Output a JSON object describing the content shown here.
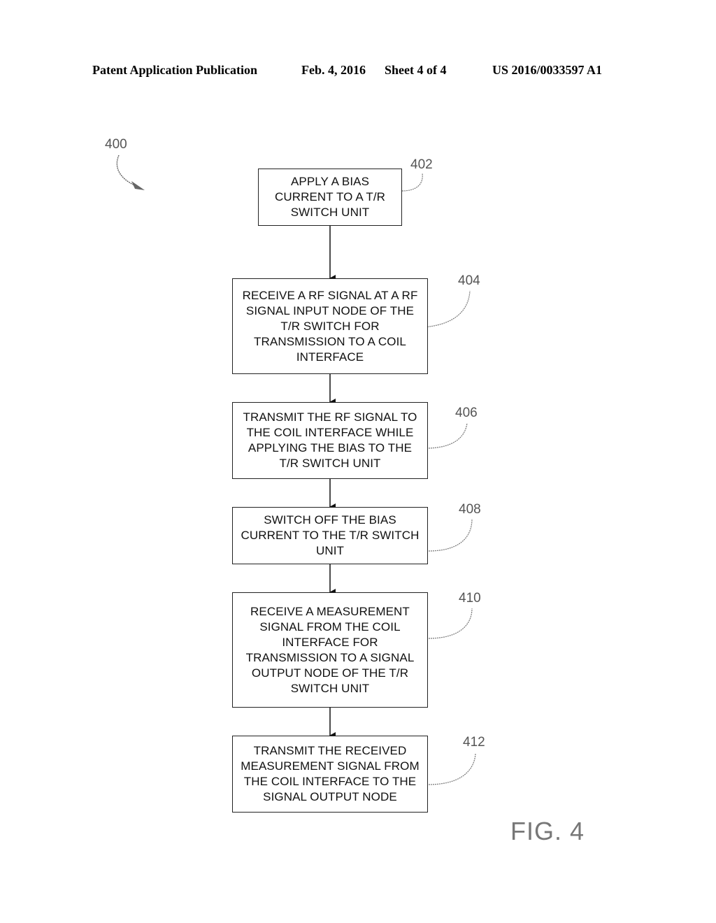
{
  "header": {
    "left": "Patent Application Publication",
    "date": "Feb. 4, 2016",
    "sheet": "Sheet 4 of 4",
    "number": "US 2016/0033597 A1"
  },
  "figure": {
    "ref": "400",
    "label": "FIG. 4"
  },
  "steps": [
    {
      "ref": "402",
      "lines": [
        "APPLY A BIAS",
        "CURRENT TO A T/R",
        "SWITCH UNIT"
      ]
    },
    {
      "ref": "404",
      "lines": [
        "RECEIVE A RF SIGNAL AT A RF",
        "SIGNAL INPUT NODE OF THE",
        "T/R SWITCH FOR",
        "TRANSMISSION TO A COIL",
        "INTERFACE"
      ]
    },
    {
      "ref": "406",
      "lines": [
        "TRANSMIT THE RF SIGNAL TO",
        "THE COIL INTERFACE WHILE",
        "APPLYING THE BIAS TO THE",
        "T/R SWITCH UNIT"
      ]
    },
    {
      "ref": "408",
      "lines": [
        "SWITCH OFF THE BIAS",
        "CURRENT TO THE T/R SWITCH",
        "UNIT"
      ]
    },
    {
      "ref": "410",
      "lines": [
        "RECEIVE A MEASUREMENT",
        "SIGNAL FROM THE COIL",
        "INTERFACE FOR",
        "TRANSMISSION TO A SIGNAL",
        "OUTPUT NODE OF THE T/R",
        "SWITCH UNIT"
      ]
    },
    {
      "ref": "412",
      "lines": [
        "TRANSMIT THE RECEIVED",
        "MEASUREMENT SIGNAL FROM",
        "THE COIL INTERFACE TO THE",
        "SIGNAL OUTPUT NODE"
      ]
    }
  ]
}
